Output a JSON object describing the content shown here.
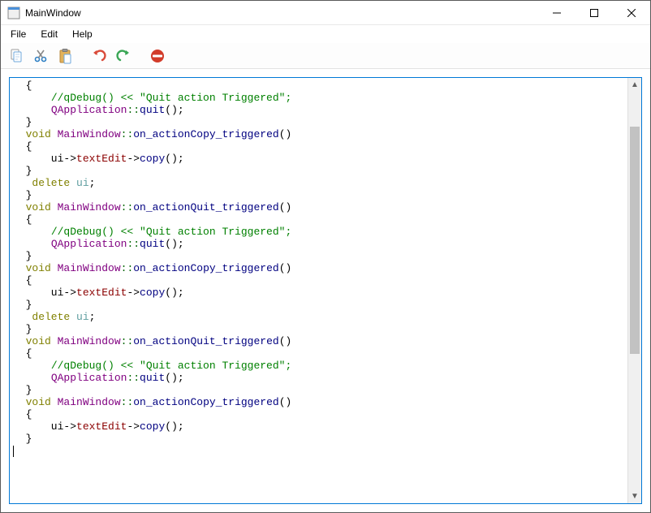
{
  "window": {
    "title": "MainWindow"
  },
  "menu": {
    "file": "File",
    "edit": "Edit",
    "help": "Help"
  },
  "toolbar": {
    "copy": "Copy",
    "cut": "Cut",
    "paste": "Paste",
    "undo": "Undo",
    "redo": "Redo",
    "stop": "Stop"
  },
  "code": {
    "lines": [
      [
        [
          "pun",
          "  {"
        ]
      ],
      [
        [
          "pun",
          "      "
        ],
        [
          "cmt",
          "//qDebug() << \"Quit action Triggered\";"
        ]
      ],
      [
        [
          "pun",
          "      "
        ],
        [
          "cls",
          "QApplication"
        ],
        [
          "scope",
          "::"
        ],
        [
          "func",
          "quit"
        ],
        [
          "pun",
          "();"
        ]
      ],
      [
        [
          "pun",
          "  }"
        ]
      ],
      [
        [
          "pun",
          ""
        ]
      ],
      [
        [
          "kw",
          "  void"
        ],
        [
          "pun",
          " "
        ],
        [
          "cls",
          "MainWindow"
        ],
        [
          "scope",
          "::"
        ],
        [
          "func",
          "on_actionCopy_triggered"
        ],
        [
          "pun",
          "()"
        ]
      ],
      [
        [
          "pun",
          "  {"
        ]
      ],
      [
        [
          "pun",
          "      ui->"
        ],
        [
          "mem",
          "textEdit"
        ],
        [
          "pun",
          "->"
        ],
        [
          "func",
          "copy"
        ],
        [
          "pun",
          "();"
        ]
      ],
      [
        [
          "pun",
          "  }"
        ]
      ],
      [
        [
          "pun",
          "   "
        ],
        [
          "kw",
          "delete"
        ],
        [
          "pun",
          " "
        ],
        [
          "del",
          "ui"
        ],
        [
          "pun",
          ";"
        ]
      ],
      [
        [
          "pun",
          "  }"
        ]
      ],
      [
        [
          "pun",
          ""
        ]
      ],
      [
        [
          "kw",
          "  void"
        ],
        [
          "pun",
          " "
        ],
        [
          "cls",
          "MainWindow"
        ],
        [
          "scope",
          "::"
        ],
        [
          "func",
          "on_actionQuit_triggered"
        ],
        [
          "pun",
          "()"
        ]
      ],
      [
        [
          "pun",
          "  {"
        ]
      ],
      [
        [
          "pun",
          "      "
        ],
        [
          "cmt",
          "//qDebug() << \"Quit action Triggered\";"
        ]
      ],
      [
        [
          "pun",
          "      "
        ],
        [
          "cls",
          "QApplication"
        ],
        [
          "scope",
          "::"
        ],
        [
          "func",
          "quit"
        ],
        [
          "pun",
          "();"
        ]
      ],
      [
        [
          "pun",
          "  }"
        ]
      ],
      [
        [
          "pun",
          ""
        ]
      ],
      [
        [
          "kw",
          "  void"
        ],
        [
          "pun",
          " "
        ],
        [
          "cls",
          "MainWindow"
        ],
        [
          "scope",
          "::"
        ],
        [
          "func",
          "on_actionCopy_triggered"
        ],
        [
          "pun",
          "()"
        ]
      ],
      [
        [
          "pun",
          "  {"
        ]
      ],
      [
        [
          "pun",
          "      ui->"
        ],
        [
          "mem",
          "textEdit"
        ],
        [
          "pun",
          "->"
        ],
        [
          "func",
          "copy"
        ],
        [
          "pun",
          "();"
        ]
      ],
      [
        [
          "pun",
          "  }"
        ]
      ],
      [
        [
          "pun",
          "   "
        ],
        [
          "kw",
          "delete"
        ],
        [
          "pun",
          " "
        ],
        [
          "del",
          "ui"
        ],
        [
          "pun",
          ";"
        ]
      ],
      [
        [
          "pun",
          "  }"
        ]
      ],
      [
        [
          "pun",
          ""
        ]
      ],
      [
        [
          "kw",
          "  void"
        ],
        [
          "pun",
          " "
        ],
        [
          "cls",
          "MainWindow"
        ],
        [
          "scope",
          "::"
        ],
        [
          "func",
          "on_actionQuit_triggered"
        ],
        [
          "pun",
          "()"
        ]
      ],
      [
        [
          "pun",
          "  {"
        ]
      ],
      [
        [
          "pun",
          "      "
        ],
        [
          "cmt",
          "//qDebug() << \"Quit action Triggered\";"
        ]
      ],
      [
        [
          "pun",
          "      "
        ],
        [
          "cls",
          "QApplication"
        ],
        [
          "scope",
          "::"
        ],
        [
          "func",
          "quit"
        ],
        [
          "pun",
          "();"
        ]
      ],
      [
        [
          "pun",
          "  }"
        ]
      ],
      [
        [
          "pun",
          ""
        ]
      ],
      [
        [
          "kw",
          "  void"
        ],
        [
          "pun",
          " "
        ],
        [
          "cls",
          "MainWindow"
        ],
        [
          "scope",
          "::"
        ],
        [
          "func",
          "on_actionCopy_triggered"
        ],
        [
          "pun",
          "()"
        ]
      ],
      [
        [
          "pun",
          "  {"
        ]
      ],
      [
        [
          "pun",
          "      ui->"
        ],
        [
          "mem",
          "textEdit"
        ],
        [
          "pun",
          "->"
        ],
        [
          "func",
          "copy"
        ],
        [
          "pun",
          "();"
        ]
      ],
      [
        [
          "pun",
          "  }"
        ]
      ]
    ]
  }
}
